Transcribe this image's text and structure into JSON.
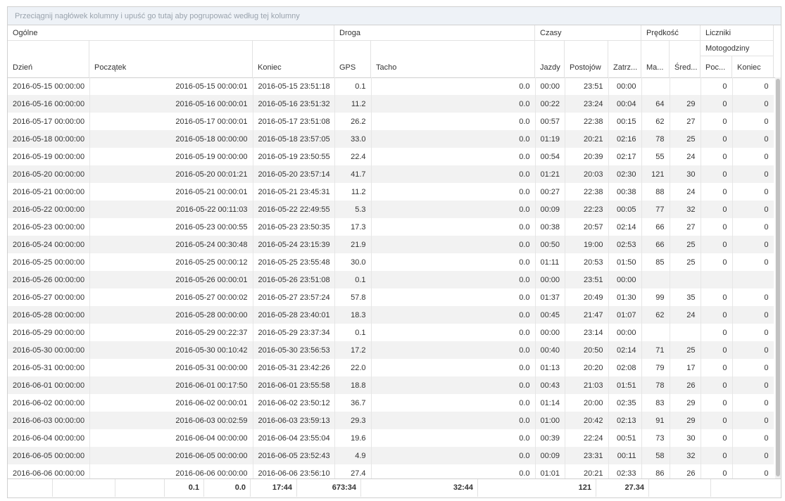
{
  "group_panel": {
    "hint": "Przeciągnij nagłówek kolumny i upuść go tutaj aby pogrupować według tej kolumny"
  },
  "header": {
    "groups": {
      "general": "Ogólne",
      "road": "Droga",
      "times": "Czasy",
      "speed": "Prędkość",
      "counters": "Liczniki"
    },
    "subgroup": {
      "engine_hours": "Motogodziny"
    },
    "columns": {
      "day": "Dzień",
      "start": "Początek",
      "end": "Koniec",
      "gps": "GPS",
      "tacho": "Tacho",
      "driving": "Jazdy",
      "stops": "Postojów",
      "halts": "Zatrz...",
      "max": "Ma...",
      "avg": "Śred...",
      "eh_start": "Poc...",
      "eh_end": "Koniec"
    }
  },
  "rows": [
    [
      "2016-05-15 00:00:00",
      "2016-05-15 00:00:01",
      "2016-05-15 23:51:18",
      "0.1",
      "0.0",
      "00:00",
      "23:51",
      "00:00",
      "",
      "",
      "0",
      "0"
    ],
    [
      "2016-05-16 00:00:00",
      "2016-05-16 00:00:01",
      "2016-05-16 23:51:32",
      "11.2",
      "0.0",
      "00:22",
      "23:24",
      "00:04",
      "64",
      "29",
      "0",
      "0"
    ],
    [
      "2016-05-17 00:00:00",
      "2016-05-17 00:00:01",
      "2016-05-17 23:51:08",
      "26.2",
      "0.0",
      "00:57",
      "22:38",
      "00:15",
      "62",
      "27",
      "0",
      "0"
    ],
    [
      "2016-05-18 00:00:00",
      "2016-05-18 00:00:00",
      "2016-05-18 23:57:05",
      "33.0",
      "0.0",
      "01:19",
      "20:21",
      "02:16",
      "78",
      "25",
      "0",
      "0"
    ],
    [
      "2016-05-19 00:00:00",
      "2016-05-19 00:00:00",
      "2016-05-19 23:50:55",
      "22.4",
      "0.0",
      "00:54",
      "20:39",
      "02:17",
      "55",
      "24",
      "0",
      "0"
    ],
    [
      "2016-05-20 00:00:00",
      "2016-05-20 00:01:21",
      "2016-05-20 23:57:14",
      "41.7",
      "0.0",
      "01:21",
      "20:03",
      "02:30",
      "121",
      "30",
      "0",
      "0"
    ],
    [
      "2016-05-21 00:00:00",
      "2016-05-21 00:00:01",
      "2016-05-21 23:45:31",
      "11.2",
      "0.0",
      "00:27",
      "22:38",
      "00:38",
      "88",
      "24",
      "0",
      "0"
    ],
    [
      "2016-05-22 00:00:00",
      "2016-05-22 00:11:03",
      "2016-05-22 22:49:55",
      "5.3",
      "0.0",
      "00:09",
      "22:23",
      "00:05",
      "77",
      "32",
      "0",
      "0"
    ],
    [
      "2016-05-23 00:00:00",
      "2016-05-23 00:00:55",
      "2016-05-23 23:50:35",
      "17.3",
      "0.0",
      "00:38",
      "20:57",
      "02:14",
      "66",
      "27",
      "0",
      "0"
    ],
    [
      "2016-05-24 00:00:00",
      "2016-05-24 00:30:48",
      "2016-05-24 23:15:39",
      "21.9",
      "0.0",
      "00:50",
      "19:00",
      "02:53",
      "66",
      "25",
      "0",
      "0"
    ],
    [
      "2016-05-25 00:00:00",
      "2016-05-25 00:00:12",
      "2016-05-25 23:55:48",
      "30.0",
      "0.0",
      "01:11",
      "20:53",
      "01:50",
      "85",
      "25",
      "0",
      "0"
    ],
    [
      "2016-05-26 00:00:00",
      "2016-05-26 00:00:01",
      "2016-05-26 23:51:08",
      "0.1",
      "0.0",
      "00:00",
      "23:51",
      "00:00",
      "",
      "",
      "",
      ""
    ],
    [
      "2016-05-27 00:00:00",
      "2016-05-27 00:00:02",
      "2016-05-27 23:57:24",
      "57.8",
      "0.0",
      "01:37",
      "20:49",
      "01:30",
      "99",
      "35",
      "0",
      "0"
    ],
    [
      "2016-05-28 00:00:00",
      "2016-05-28 00:00:00",
      "2016-05-28 23:40:01",
      "18.3",
      "0.0",
      "00:45",
      "21:47",
      "01:07",
      "62",
      "24",
      "0",
      "0"
    ],
    [
      "2016-05-29 00:00:00",
      "2016-05-29 00:22:37",
      "2016-05-29 23:37:34",
      "0.1",
      "0.0",
      "00:00",
      "23:14",
      "00:00",
      "",
      "",
      "0",
      "0"
    ],
    [
      "2016-05-30 00:00:00",
      "2016-05-30 00:10:42",
      "2016-05-30 23:56:53",
      "17.2",
      "0.0",
      "00:40",
      "20:50",
      "02:14",
      "71",
      "25",
      "0",
      "0"
    ],
    [
      "2016-05-31 00:00:00",
      "2016-05-31 00:00:00",
      "2016-05-31 23:42:26",
      "22.0",
      "0.0",
      "01:13",
      "20:20",
      "02:08",
      "79",
      "17",
      "0",
      "0"
    ],
    [
      "2016-06-01 00:00:00",
      "2016-06-01 00:17:50",
      "2016-06-01 23:55:58",
      "18.8",
      "0.0",
      "00:43",
      "21:03",
      "01:51",
      "78",
      "26",
      "0",
      "0"
    ],
    [
      "2016-06-02 00:00:00",
      "2016-06-02 00:00:01",
      "2016-06-02 23:50:12",
      "36.7",
      "0.0",
      "01:14",
      "20:00",
      "02:35",
      "83",
      "29",
      "0",
      "0"
    ],
    [
      "2016-06-03 00:00:00",
      "2016-06-03 00:02:59",
      "2016-06-03 23:59:13",
      "29.3",
      "0.0",
      "01:00",
      "20:42",
      "02:13",
      "91",
      "29",
      "0",
      "0"
    ],
    [
      "2016-06-04 00:00:00",
      "2016-06-04 00:00:00",
      "2016-06-04 23:55:04",
      "19.6",
      "0.0",
      "00:39",
      "22:24",
      "00:51",
      "73",
      "30",
      "0",
      "0"
    ],
    [
      "2016-06-05 00:00:00",
      "2016-06-05 00:00:00",
      "2016-06-05 23:52:43",
      "4.9",
      "0.0",
      "00:09",
      "23:31",
      "00:11",
      "58",
      "32",
      "0",
      "0"
    ],
    [
      "2016-06-06 00:00:00",
      "2016-06-06 00:00:00",
      "2016-06-06 23:56:10",
      "27.4",
      "0.0",
      "01:01",
      "20:21",
      "02:33",
      "86",
      "26",
      "0",
      "0"
    ]
  ],
  "footer": {
    "values": [
      "",
      "",
      "",
      "0.1",
      "0.0",
      "17:44",
      "673:34",
      "32:44",
      "121",
      "27.34",
      "",
      ""
    ]
  }
}
